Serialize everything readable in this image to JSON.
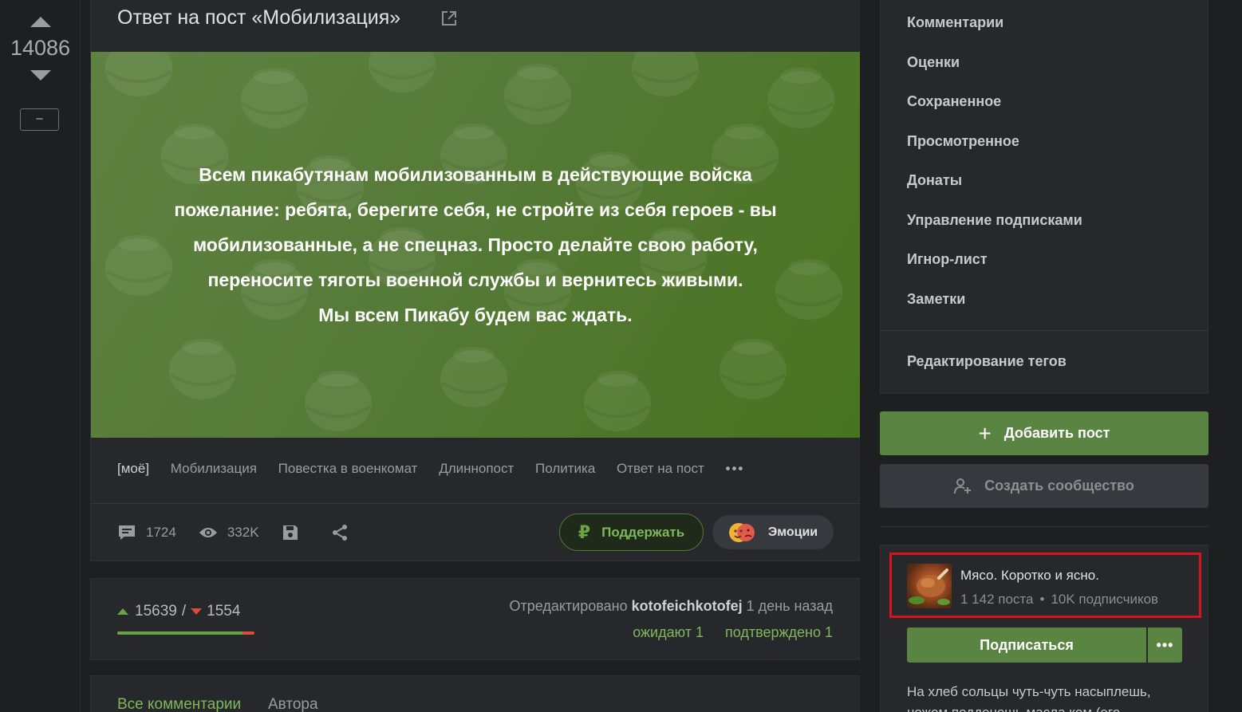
{
  "vote": {
    "score": "14086",
    "collapse_label": "–"
  },
  "story": {
    "title": "Ответ на пост «Мобилизация»",
    "banner_lines": [
      "Всем пикабутянам мобилизованным в действующие войска",
      "пожелание: ребята, берегите себя, не стройте из себя героев - вы",
      "мобилизованные, а не спецназ.  Просто делайте свою работу,",
      "переносите тяготы военной службы и вернитесь живыми.",
      "Мы всем Пикабу будем вас ждать."
    ],
    "tags": [
      "[моё]",
      "Мобилизация",
      "Повестка в военкомат",
      "Длиннопост",
      "Политика",
      "Ответ на пост",
      "•••"
    ],
    "comments_count": "1724",
    "views_count": "332K",
    "support_label": "Поддержать",
    "emotions_label": "Эмоции"
  },
  "rating": {
    "pluses": "15639",
    "separator": "/",
    "minuses": "1554",
    "plus_fraction": 0.91,
    "edited_prefix": "Отредактировано",
    "edited_user": "kotofeichkotofej",
    "edited_time": "1 день назад",
    "pending": "ожидают 1",
    "confirmed": "подтверждено 1"
  },
  "comments": {
    "tab_all": "Все комментарии",
    "tab_author": "Автора"
  },
  "menu": {
    "items": [
      "Комментарии",
      "Оценки",
      "Сохраненное",
      "Просмотренное",
      "Донаты",
      "Управление подписками",
      "Игнор-лист",
      "Заметки"
    ],
    "edit_tags": "Редактирование тегов"
  },
  "sidebar": {
    "add_post": "Добавить пост",
    "create_community": "Создать сообщество"
  },
  "community": {
    "name": "Мясо. Коротко и ясно.",
    "posts": "1 142 поста",
    "subscribers": "10K подписчиков",
    "subscribe": "Подписаться",
    "more": "•••",
    "description": "На хлеб сольцы чуть-чуть насыплешь, ножом подденешь масла ком (его"
  },
  "colors": {
    "accent_green": "#5a8441",
    "highlight_red": "#d8121f",
    "minus_red": "#e04a3a"
  }
}
